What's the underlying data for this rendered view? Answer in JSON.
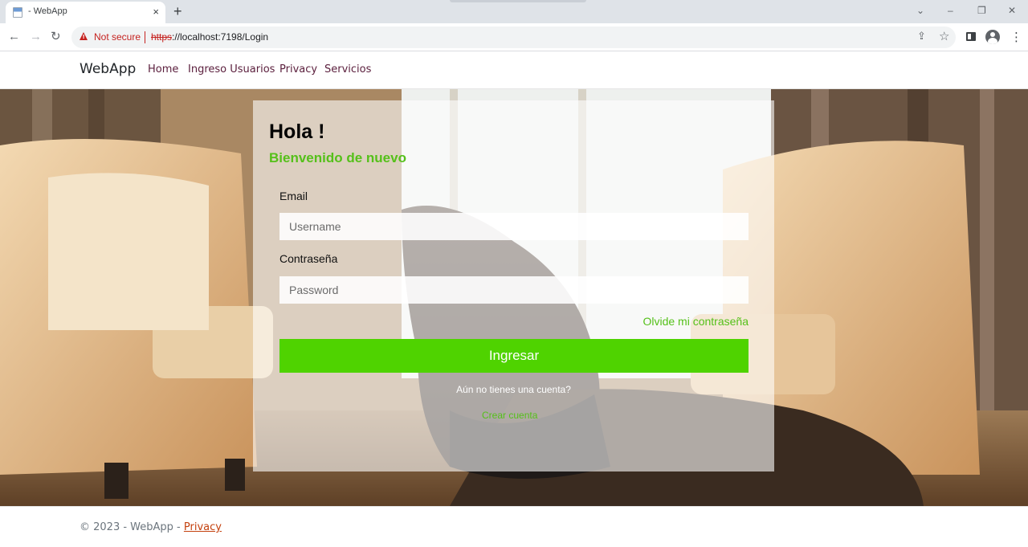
{
  "browser": {
    "tab_title": "- WebApp",
    "tab_close": "×",
    "new_tab": "+",
    "window_controls": {
      "tab_search": "⌄",
      "minimize": "–",
      "restore": "❐",
      "close": "✕"
    },
    "nav": {
      "back": "←",
      "forward": "→",
      "reload": "↻"
    },
    "security_label": "Not secure",
    "url_scheme": "https",
    "url_rest": "://localhost:7198/Login",
    "icons": [
      "share-icon",
      "star-icon",
      "side-panel-icon",
      "profile-icon",
      "menu-icon"
    ],
    "menu_glyph": "⋮",
    "star_glyph": "☆",
    "share_glyph": "⇪"
  },
  "navbar": {
    "brand": "WebApp",
    "links": [
      "Home",
      "Ingreso Usuarios",
      "Privacy",
      "Servicios"
    ],
    "link_color": "#5a1e3c"
  },
  "login": {
    "heading": "Hola !",
    "subheading": "Bienvenido de nuevo",
    "email_label": "Email",
    "email_placeholder": "Username",
    "password_label": "Contraseña",
    "password_placeholder": "Password",
    "forgot_link": "Olvide mi contraseña",
    "submit_label": "Ingresar",
    "no_account_text": "Aún no tienes una cuenta?",
    "create_account_link": "Crear cuenta",
    "accent_color": "#4fd300"
  },
  "footer": {
    "copyright": "© 2023 - WebApp - ",
    "privacy_link": "Privacy"
  }
}
